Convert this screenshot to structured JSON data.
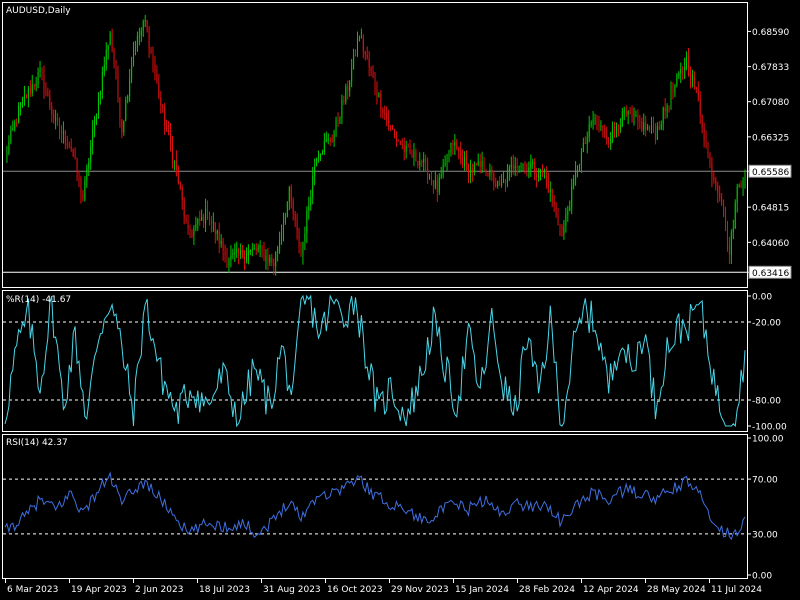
{
  "colors": {
    "background": "#000000",
    "frame": "#ffffff",
    "bull": "#00c800",
    "bear": "#e01010",
    "wpr_line": "#4ad6e8",
    "rsi_line": "#3f6fe0",
    "level_line": "#ffffff",
    "price_line": "#8c8c8c"
  },
  "chart_data": [
    {
      "type": "candlestick",
      "title": "AUDUSD,Daily",
      "y_ticks": [
        "0.68590",
        "0.67833",
        "0.67080",
        "0.66325",
        "0.65586",
        "0.64815",
        "0.64060",
        "0.63416"
      ],
      "ylim": [
        0.631,
        0.692
      ],
      "current_price_label": "0.65586",
      "current_price": 0.65586,
      "low_marker_label": "0.63416",
      "low_marker": 0.63416,
      "keypoints": [
        [
          0,
          0.659
        ],
        [
          8,
          0.67
        ],
        [
          18,
          0.677
        ],
        [
          26,
          0.666
        ],
        [
          34,
          0.661
        ],
        [
          40,
          0.65
        ],
        [
          48,
          0.672
        ],
        [
          54,
          0.686
        ],
        [
          60,
          0.665
        ],
        [
          66,
          0.682
        ],
        [
          72,
          0.688
        ],
        [
          80,
          0.67
        ],
        [
          88,
          0.656
        ],
        [
          94,
          0.642
        ],
        [
          104,
          0.647
        ],
        [
          114,
          0.637
        ],
        [
          122,
          0.638
        ],
        [
          130,
          0.639
        ],
        [
          138,
          0.636
        ],
        [
          146,
          0.651
        ],
        [
          152,
          0.638
        ],
        [
          160,
          0.66
        ],
        [
          168,
          0.663
        ],
        [
          176,
          0.674
        ],
        [
          182,
          0.685
        ],
        [
          190,
          0.674
        ],
        [
          198,
          0.665
        ],
        [
          206,
          0.66
        ],
        [
          214,
          0.658
        ],
        [
          222,
          0.652
        ],
        [
          230,
          0.662
        ],
        [
          238,
          0.656
        ],
        [
          246,
          0.657
        ],
        [
          254,
          0.652
        ],
        [
          262,
          0.658
        ],
        [
          270,
          0.657
        ],
        [
          278,
          0.654
        ],
        [
          286,
          0.642
        ],
        [
          294,
          0.657
        ],
        [
          302,
          0.667
        ],
        [
          310,
          0.663
        ],
        [
          318,
          0.668
        ],
        [
          326,
          0.666
        ],
        [
          334,
          0.664
        ],
        [
          342,
          0.672
        ],
        [
          350,
          0.68
        ],
        [
          356,
          0.671
        ],
        [
          362,
          0.657
        ],
        [
          368,
          0.65
        ],
        [
          372,
          0.638
        ],
        [
          376,
          0.652
        ],
        [
          380,
          0.656
        ]
      ],
      "n_candles": 381
    },
    {
      "type": "line",
      "title": "%R(14) -41.67",
      "y_ticks": [
        "0.00",
        "-20.00",
        "-80.00",
        "-100.00"
      ],
      "ylim": [
        -100,
        0
      ],
      "levels": [
        -20,
        -80
      ],
      "last_value": -41.67,
      "keypoints": [
        [
          0,
          -92
        ],
        [
          6,
          -40
        ],
        [
          12,
          -15
        ],
        [
          18,
          -70
        ],
        [
          24,
          -5
        ],
        [
          30,
          -85
        ],
        [
          36,
          -30
        ],
        [
          42,
          -95
        ],
        [
          48,
          -30
        ],
        [
          54,
          -2
        ],
        [
          60,
          -40
        ],
        [
          66,
          -90
        ],
        [
          72,
          -5
        ],
        [
          80,
          -60
        ],
        [
          88,
          -90
        ],
        [
          96,
          -70
        ],
        [
          104,
          -85
        ],
        [
          112,
          -60
        ],
        [
          120,
          -95
        ],
        [
          128,
          -55
        ],
        [
          136,
          -85
        ],
        [
          142,
          -40
        ],
        [
          148,
          -80
        ],
        [
          152,
          -10
        ],
        [
          156,
          -2
        ],
        [
          162,
          -30
        ],
        [
          168,
          -5
        ],
        [
          174,
          -15
        ],
        [
          180,
          -2
        ],
        [
          186,
          -50
        ],
        [
          192,
          -90
        ],
        [
          198,
          -70
        ],
        [
          206,
          -95
        ],
        [
          214,
          -60
        ],
        [
          220,
          -20
        ],
        [
          226,
          -55
        ],
        [
          232,
          -85
        ],
        [
          238,
          -30
        ],
        [
          244,
          -75
        ],
        [
          250,
          -20
        ],
        [
          256,
          -70
        ],
        [
          262,
          -90
        ],
        [
          268,
          -30
        ],
        [
          274,
          -75
        ],
        [
          280,
          -20
        ],
        [
          286,
          -98
        ],
        [
          292,
          -40
        ],
        [
          298,
          -10
        ],
        [
          304,
          -25
        ],
        [
          310,
          -70
        ],
        [
          316,
          -30
        ],
        [
          322,
          -60
        ],
        [
          328,
          -25
        ],
        [
          334,
          -85
        ],
        [
          340,
          -40
        ],
        [
          346,
          -25
        ],
        [
          352,
          -20
        ],
        [
          356,
          -5
        ],
        [
          360,
          -30
        ],
        [
          366,
          -80
        ],
        [
          372,
          -97
        ],
        [
          376,
          -85
        ],
        [
          380,
          -41.67
        ]
      ],
      "n_points": 381
    },
    {
      "type": "line",
      "title": "RSI(14) 42.37",
      "y_ticks": [
        "100.00",
        "70.00",
        "30.00",
        "0.00"
      ],
      "ylim": [
        0,
        100
      ],
      "levels": [
        70,
        30
      ],
      "last_value": 42.37,
      "keypoints": [
        [
          0,
          32
        ],
        [
          10,
          42
        ],
        [
          18,
          55
        ],
        [
          26,
          48
        ],
        [
          34,
          60
        ],
        [
          40,
          45
        ],
        [
          48,
          62
        ],
        [
          54,
          72
        ],
        [
          60,
          52
        ],
        [
          66,
          62
        ],
        [
          72,
          68
        ],
        [
          80,
          55
        ],
        [
          88,
          42
        ],
        [
          94,
          30
        ],
        [
          104,
          38
        ],
        [
          114,
          35
        ],
        [
          122,
          38
        ],
        [
          130,
          30
        ],
        [
          138,
          40
        ],
        [
          146,
          55
        ],
        [
          152,
          42
        ],
        [
          160,
          58
        ],
        [
          168,
          60
        ],
        [
          176,
          66
        ],
        [
          182,
          70
        ],
        [
          190,
          58
        ],
        [
          198,
          52
        ],
        [
          206,
          48
        ],
        [
          214,
          40
        ],
        [
          222,
          45
        ],
        [
          230,
          52
        ],
        [
          238,
          48
        ],
        [
          246,
          55
        ],
        [
          254,
          45
        ],
        [
          262,
          52
        ],
        [
          270,
          50
        ],
        [
          278,
          52
        ],
        [
          286,
          38
        ],
        [
          294,
          52
        ],
        [
          302,
          60
        ],
        [
          310,
          55
        ],
        [
          318,
          62
        ],
        [
          326,
          60
        ],
        [
          334,
          55
        ],
        [
          342,
          62
        ],
        [
          350,
          68
        ],
        [
          356,
          60
        ],
        [
          362,
          45
        ],
        [
          368,
          32
        ],
        [
          372,
          30
        ],
        [
          376,
          32
        ],
        [
          380,
          42.37
        ]
      ],
      "n_points": 381
    }
  ],
  "x_labels": [
    "6 Mar 2023",
    "19 Apr 2023",
    "2 Jun 2023",
    "18 Jul 2023",
    "31 Aug 2023",
    "16 Oct 2023",
    "29 Nov 2023",
    "15 Jan 2024",
    "28 Feb 2024",
    "12 Apr 2024",
    "28 May 2024",
    "11 Jul 2024"
  ]
}
